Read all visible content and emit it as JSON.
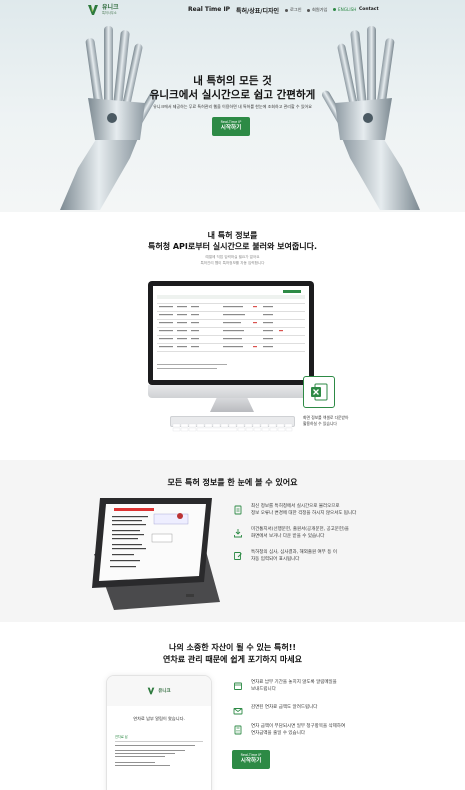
{
  "nav": {
    "logo_ko": "유니크",
    "logo_en": "특허사무소",
    "items": [
      "Real Time IP",
      "특허/상표/디자인"
    ],
    "login": "로그인",
    "signup": "회원가입",
    "english": "ENGLISH",
    "contact": "Contact"
  },
  "hero": {
    "line1": "내 특허의 모든 것",
    "line2": "유니크에서 실시간으로 쉽고 간편하게",
    "sub": "유니크에서 제공하는 무료 특허관리 웹을 이용하면 내 특허를 한눈에 조회하고 관리할 수 있어요",
    "btn_top": "Real-Time IP",
    "btn_main": "시작하기"
  },
  "section2": {
    "title1": "내 특허 정보를",
    "title2": "특허청 API로부터 실시간으로 불러와 보여줍니다.",
    "desc1": "예열에 직접 입력하실 필요가 없어요",
    "desc2": "특허관리 웹이 특허정보를 자동 입력합니다",
    "caption1": "화면 정보를 엑셀로 다운받아",
    "caption2": "활용하실 수 있습니다"
  },
  "section3": {
    "title": "모든 특허 정보를 한 눈에 볼 수 있어요",
    "features": [
      {
        "icon": "document-icon",
        "lines": [
          "최신 정보를 특허청에서 실시간으로 불러오므로",
          "정보 오류나 변경에 대한 걱정을 하시지 않으셔도 됩니다"
        ]
      },
      {
        "icon": "download-icon",
        "lines": [
          "미건통지서(선행문헌, 출원서(공개문헌, 공고문헌)을",
          "화면에서 보거나 다운 받을 수 있습니다"
        ]
      },
      {
        "icon": "edit-icon",
        "lines": [
          "특허청의 심사, 심사결과, 해외출원 여부 등 이",
          "자동 입력되어 표시됩니다"
        ]
      }
    ]
  },
  "section4": {
    "title1": "나의 소중한 자산이 될 수 있는 특허!!",
    "title2": "연차료 관리 때문에 쉽게 포기하지 마세요",
    "phone_logo": "유니크",
    "phone_title": "연차료 납부 알림이 왔습니다.",
    "phone_label": "연차료 납",
    "features": [
      {
        "icon": "calendar-icon",
        "lines": [
          "연차료 납부 기간을 놓치지 않도록 알림메일을",
          "보내드립니다"
        ]
      },
      {
        "icon": "mail-icon",
        "lines": [
          "감면된 연차료 금액도 알려드립니다"
        ]
      },
      {
        "icon": "calculator-icon",
        "lines": [
          "연차 금액이 부담되시면 일부 청구항목을 삭제하여",
          "연차금액을 줄일 수 있습니다"
        ]
      }
    ],
    "btn_top": "Real-Time IP",
    "btn_main": "시작하기"
  }
}
